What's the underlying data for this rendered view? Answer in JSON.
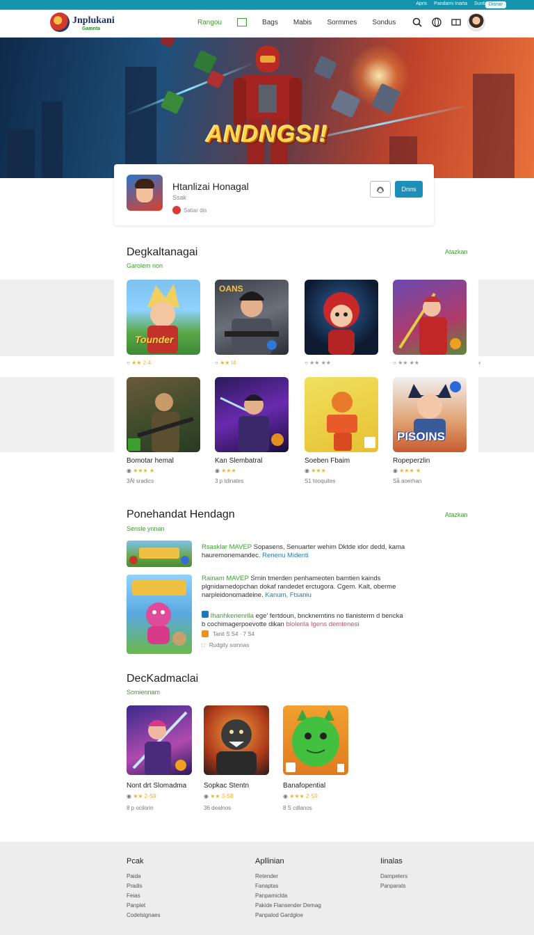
{
  "topbar": {
    "links": [
      "Apris",
      "Pandarni Inarta",
      "Sunti"
    ],
    "pill": "Disnar"
  },
  "nav": {
    "brand": "Jnplukani",
    "brand_sub": "Gamnta",
    "items": [
      {
        "label": "Rangou",
        "active": true
      },
      {
        "label": "Bags"
      },
      {
        "label": "Mabis"
      },
      {
        "label": "Sormmes"
      },
      {
        "label": "Sondus"
      }
    ]
  },
  "hero": {
    "title": "ANDNGSI!"
  },
  "app": {
    "name": "Htanlizai Honagal",
    "sub": "Ssak",
    "meta": "Satiar dis",
    "primary_button": "Dnns"
  },
  "section1": {
    "title": "Degkaltanagai",
    "sub": "Garolem non",
    "link": "Atazkan",
    "row1": [
      {
        "rating": "★★ 2·4",
        "badge_text": "Tounder"
      },
      {
        "rating": "★★ t4",
        "badge_text": "OANS"
      },
      {
        "rating": "★★ ★★"
      },
      {
        "rating": "★★ ★★"
      }
    ],
    "row2": [
      {
        "name": "Bomotar hemal",
        "rating": "★★★ ★",
        "downloads": "3Äl sradics"
      },
      {
        "name": "Kan Slembatral",
        "rating": "★★★",
        "downloads": "3 p tdinates"
      },
      {
        "name": "Soeben Fbaim",
        "rating": "★★★",
        "downloads": "S1 tooquites"
      },
      {
        "name": "Ropeperzlin",
        "rating": "★★★ ★",
        "downloads": "Så aoerhan",
        "art_text": "PISOINS"
      }
    ]
  },
  "section2": {
    "title": "Ponehandat Hendagn",
    "sub": "Sensle ynnan",
    "link": "Atazkan",
    "items": [
      {
        "lead": "Rsasklar MAVEP",
        "text": "Sopasens, Senuarter wehim Dktde idor dedd, kama",
        "text2": "hauremonemandec.",
        "link": "Renenu Midenti"
      },
      {
        "lead": "Rainam MAVEP",
        "text": "Srnin tmerden penhameoten bamtien kainds",
        "text2": "plgnidarnedopchan dokaf randedet erctugora. Cgem. Kalt, oberme",
        "text3": "narpleidonomadeine.",
        "link": "Kanum, Ftsaniu"
      },
      {
        "lead": "Ihanhkenenrila",
        "text": "ege' fertdoun, bncknemtins no tlanisterm d bencka",
        "text2": "b cochimagerpoevotte dikan",
        "link": "blolerila Igens demtenesi"
      }
    ],
    "small1": "Tanit S S4 · 7 S4",
    "small2": "Rudgity somnas"
  },
  "section3": {
    "title": "DecKadmaclai",
    "sub": "Somiennam",
    "items": [
      {
        "name": "Nont drt Slomadma",
        "rating": "★★ 2·S9",
        "downloads": "8 p ocilorin"
      },
      {
        "name": "Sopkac Stentn",
        "rating": "★★ 3·S8",
        "downloads": "36 dealnos"
      },
      {
        "name": "Banafopential",
        "rating": "★★★ 2·S9",
        "downloads": "8 S cdlanos"
      }
    ]
  },
  "footer": {
    "cols": [
      {
        "title": "Pcak",
        "items": [
          "Paida",
          "Pradis",
          "Feias",
          "Panplet",
          "Codelsignaes"
        ]
      },
      {
        "title": "Apllinian",
        "items": [
          "Retender",
          "Fanaptas",
          "Panpamiclda",
          "Pakide Flansender Demag",
          "Panpalod Gardgloe"
        ]
      },
      {
        "title": "Iinalas",
        "items": [
          "Dampeters",
          "Panparats"
        ]
      }
    ]
  },
  "colors": {
    "accent": "#3a9f2f",
    "topbar": "#1594ad",
    "primary": "#1d8fb8"
  },
  "icons": [
    "search-icon",
    "globe-icon",
    "bookmark-icon",
    "edit-icon",
    "chevron-left-icon"
  ]
}
